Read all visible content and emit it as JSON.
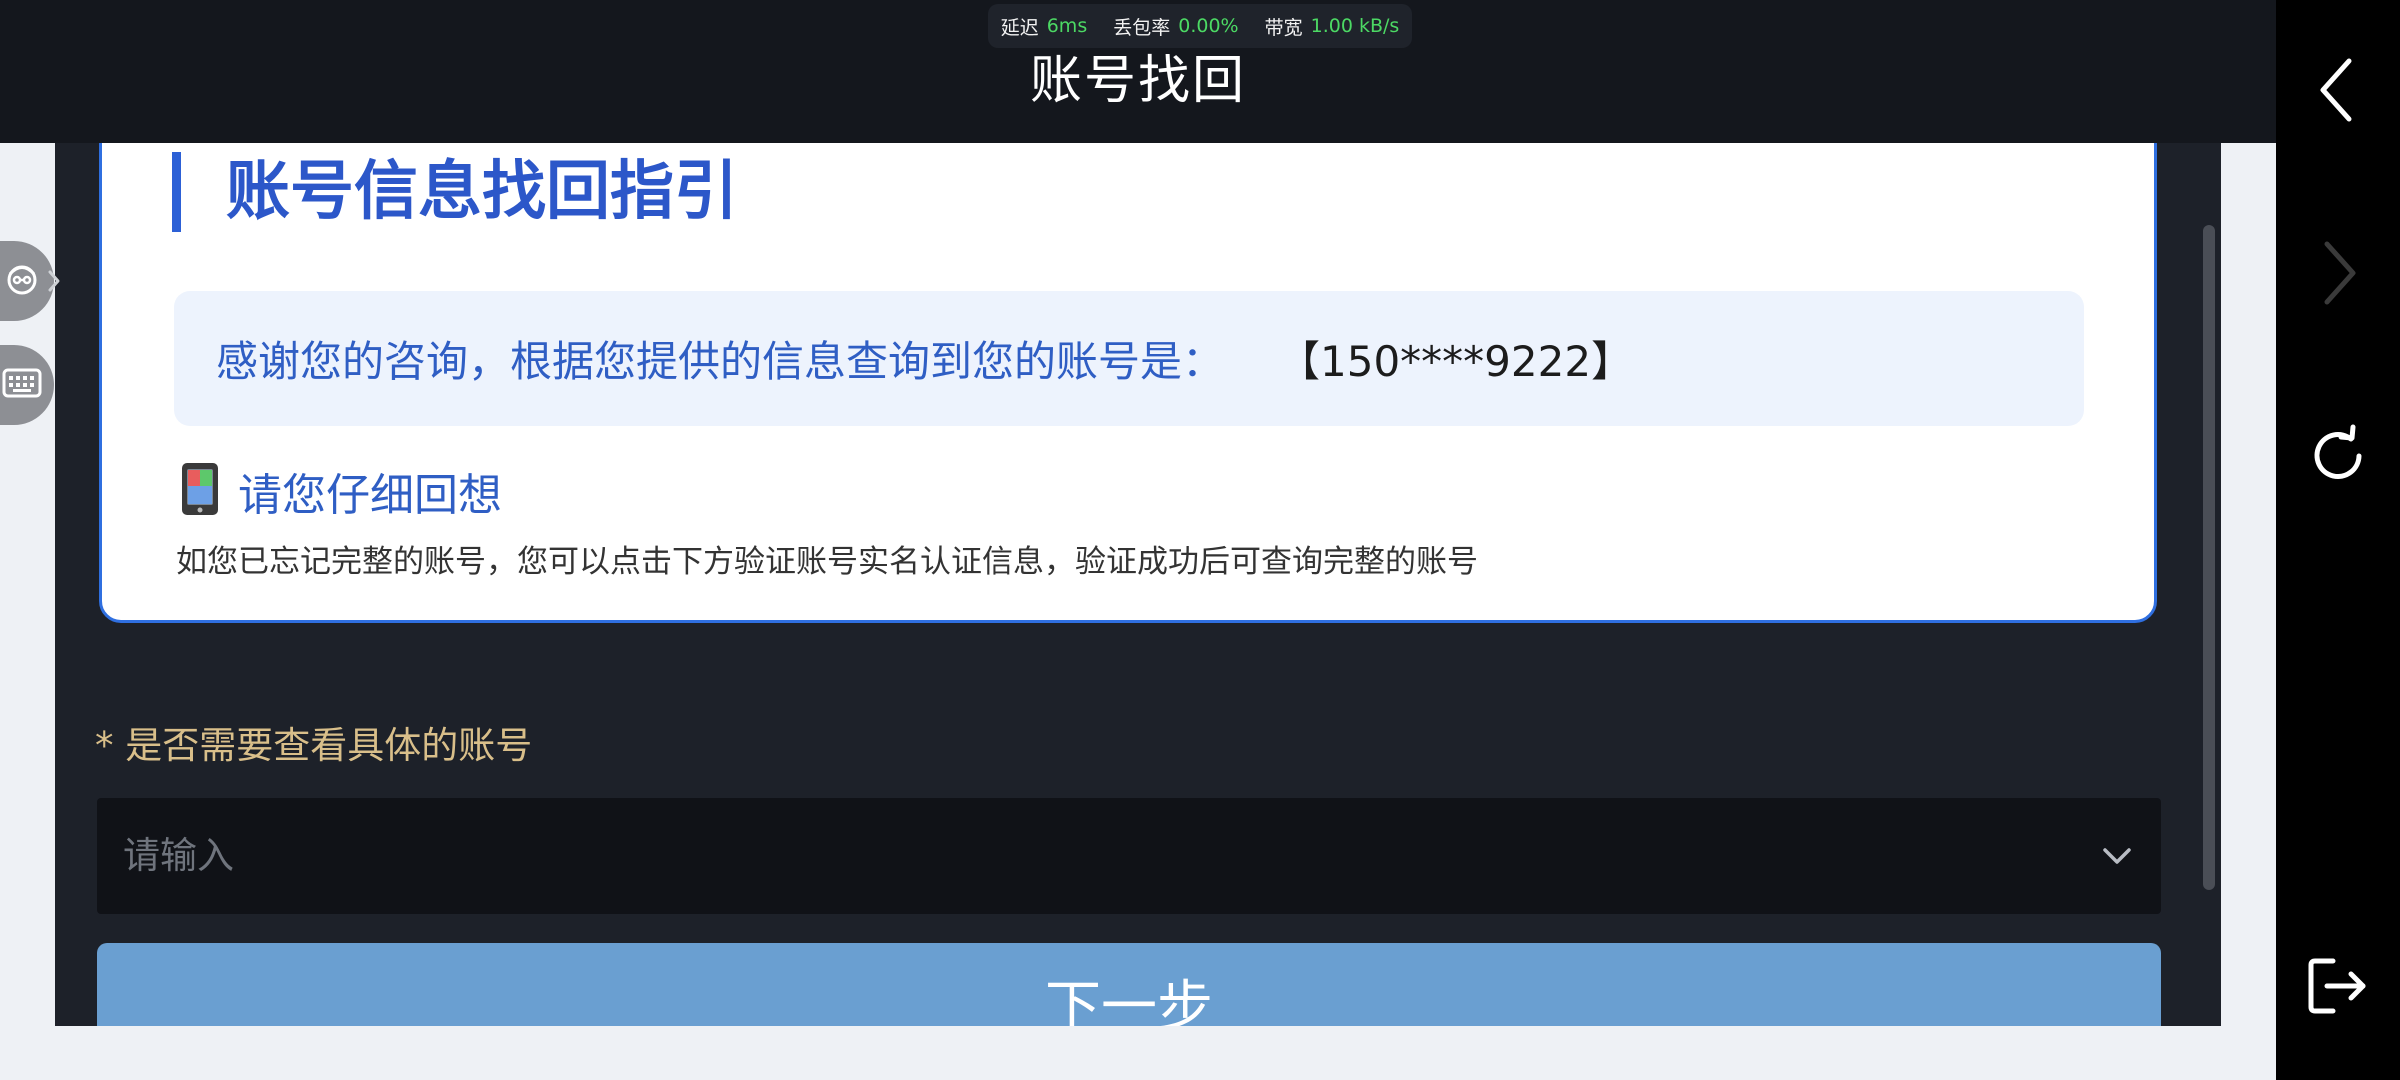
{
  "status_bar": {
    "latency_label": "延迟",
    "latency_value": "6ms",
    "loss_label": "丢包率",
    "loss_value": "0.00%",
    "bandwidth_label": "带宽",
    "bandwidth_value": "1.00 kB/s"
  },
  "header": {
    "title": "账号找回"
  },
  "card": {
    "heading": "账号信息找回指引",
    "info_text": "感谢您的咨询，根据您提供的信息查询到您的账号是：",
    "account": "【150****9222】",
    "hint_title": "请您仔细回想",
    "hint_desc": "如您已忘记完整的账号，您可以点击下方验证账号实名认证信息，验证成功后可查询完整的账号"
  },
  "form": {
    "question_label": "* 是否需要查看具体的账号",
    "select_placeholder": "请输入",
    "next_label": "下一步"
  },
  "nav_icons": [
    "back-icon",
    "forward-icon",
    "refresh-icon",
    "exit-icon"
  ],
  "float_icons": [
    "avatar-icon",
    "keyboard-icon"
  ],
  "colors": {
    "accent_blue": "#2f6fe0",
    "label_gold": "#d9bf8a",
    "button_blue": "#6a9fd1",
    "stat_green": "#4cd964"
  }
}
